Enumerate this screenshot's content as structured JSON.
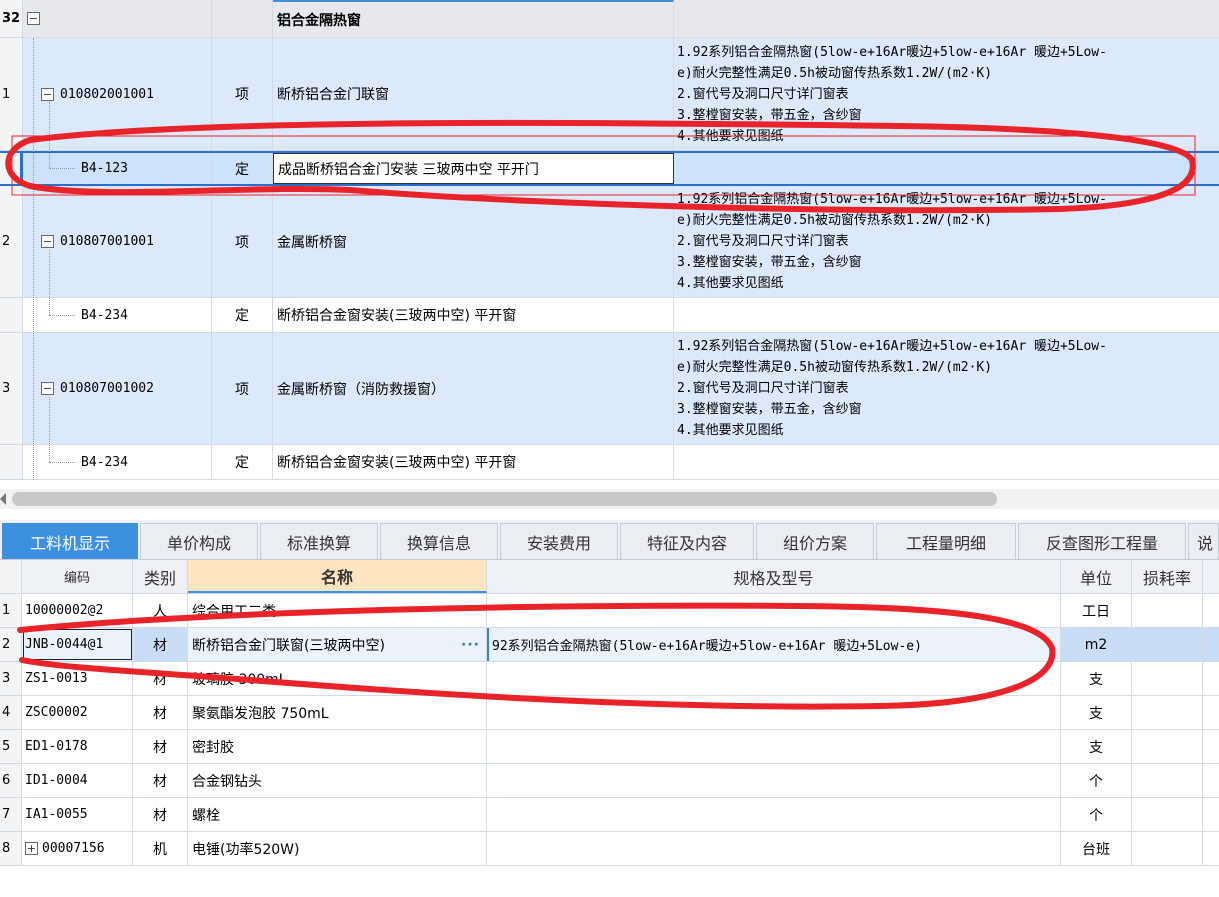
{
  "upper": {
    "group_row": {
      "no": "32",
      "toggle": "−",
      "name": "铝合金隔热窗"
    },
    "rows": [
      {
        "no": "1",
        "code": "010802001001",
        "type": "项",
        "name": "断桥铝合金门联窗",
        "feature": "1.92系列铝合金隔热窗(5low-e+16Ar暖边+5low-e+16Ar 暖边+5Low-\ne)耐火完整性满足0.5h被动窗传热系数1.2W/(m2·K)\n2.窗代号及洞口尺寸详门窗表\n3.整樘窗安装，带五金，含纱窗\n4.其他要求见图纸"
      },
      {
        "no": "",
        "code": "B4-123",
        "type": "定",
        "name": "成品断桥铝合金门安装 三玻两中空 平开门",
        "feature": ""
      },
      {
        "no": "2",
        "code": "010807001001",
        "type": "项",
        "name": "金属断桥窗",
        "feature": "1.92系列铝合金隔热窗(5low-e+16Ar暖边+5low-e+16Ar 暖边+5Low-\ne)耐火完整性满足0.5h被动窗传热系数1.2W/(m2·K)\n2.窗代号及洞口尺寸详门窗表\n3.整樘窗安装，带五金，含纱窗\n4.其他要求见图纸"
      },
      {
        "no": "",
        "code": "B4-234",
        "type": "定",
        "name": "断桥铝合金窗安装(三玻两中空) 平开窗",
        "feature": ""
      },
      {
        "no": "3",
        "code": "010807001002",
        "type": "项",
        "name": "金属断桥窗（消防救援窗）",
        "feature": "1.92系列铝合金隔热窗(5low-e+16Ar暖边+5low-e+16Ar 暖边+5Low-\ne)耐火完整性满足0.5h被动窗传热系数1.2W/(m2·K)\n2.窗代号及洞口尺寸详门窗表\n3.整樘窗安装，带五金，含纱窗\n4.其他要求见图纸"
      },
      {
        "no": "",
        "code": "B4-234",
        "type": "定",
        "name": "断桥铝合金窗安装(三玻两中空) 平开窗",
        "feature": ""
      }
    ]
  },
  "tabs": [
    "工料机显示",
    "单价构成",
    "标准换算",
    "换算信息",
    "安装费用",
    "特征及内容",
    "组价方案",
    "工程量明细",
    "反查图形工程量",
    "说"
  ],
  "lower": {
    "headers": {
      "code": "编码",
      "type": "类别",
      "name": "名称",
      "spec": "规格及型号",
      "unit": "单位",
      "loss": "损耗率"
    },
    "rows": [
      {
        "no": "1",
        "code": "10000002@2",
        "type": "人",
        "name": "综合用工二类",
        "spec": "",
        "unit": "工日"
      },
      {
        "no": "2",
        "code": "JNB-0044@1",
        "type": "材",
        "name": "断桥铝合金门联窗(三玻两中空)",
        "spec": "92系列铝合金隔热窗(5low-e+16Ar暖边+5low-e+16Ar 暖边+5Low-e)",
        "unit": "m2",
        "more": "···"
      },
      {
        "no": "3",
        "code": "ZS1-0013",
        "type": "材",
        "name": "玻璃胶 300mL",
        "spec": "",
        "unit": "支"
      },
      {
        "no": "4",
        "code": "ZSC00002",
        "type": "材",
        "name": "聚氨酯发泡胶 750mL",
        "spec": "",
        "unit": "支"
      },
      {
        "no": "5",
        "code": "ED1-0178",
        "type": "材",
        "name": "密封胶",
        "spec": "",
        "unit": "支"
      },
      {
        "no": "6",
        "code": "ID1-0004",
        "type": "材",
        "name": "合金钢钻头",
        "spec": "",
        "unit": "个"
      },
      {
        "no": "7",
        "code": "IA1-0055",
        "type": "材",
        "name": "螺栓",
        "spec": "",
        "unit": "个"
      },
      {
        "no": "8",
        "code": "00007156",
        "type": "机",
        "name": "电锤(功率520W)",
        "spec": "",
        "unit": "台班",
        "toggle": "+"
      }
    ]
  },
  "colors": {
    "accent": "#3d8fe0",
    "annotation": "#e8242a",
    "selection": "#cde3fa"
  }
}
